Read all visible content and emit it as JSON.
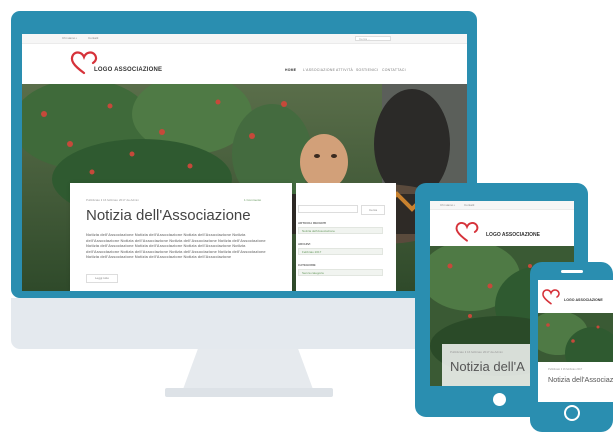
{
  "site": {
    "logo_text": "LOGO ASSOCIAZIONE",
    "topbar_links": [
      "Chi siamo  •",
      "Contatti"
    ],
    "search_placeholder": "Cerca ...",
    "nav": [
      "HOME",
      "L'ASSOCIAZIONE",
      "ATTIVITÀ",
      "SOSTIENICI",
      "CONTATTACI"
    ]
  },
  "article": {
    "meta": "Pubblicato il 16 febbraio 2017 da Admin",
    "comments": "1 Commento",
    "title": "Notizia dell'Associazione",
    "body": "Notizia dell'Associazione Notizia dell'Associazione Notizia dell'Associazione Notizia dell'Associazione Notizia dell'Associazione Notizia dell'Associazione Notizia dell'Associazione Notizia dell'Associazione Notizia dell'Associazione Notizia dell'Associazione Notizia dell'Associazione Notizia dell'Associazione Notizia dell'Associazione Notizia dell'Associazione Notizia dell'Associazione Notizia dell'Associazione Notizia dell'Associazione",
    "read_more": "Leggi tutto"
  },
  "sidebar": {
    "search_btn": "Cerca",
    "sections": [
      {
        "heading": "ARTICOLI RECENTI",
        "item": "Notizia dell'Associazione"
      },
      {
        "heading": "ARCHIVI",
        "item": "Febbraio 2017"
      },
      {
        "heading": "CATEGORIE",
        "item": "Senza categoria"
      }
    ]
  },
  "tablet": {
    "topbar_links": [
      "Chi siamo  •",
      "Contatti"
    ],
    "logo_text": "LOGO ASSOCIAZIONE",
    "meta": "Pubblicato il 16 febbraio 2017 da Admin",
    "title": "Notizia dell'A"
  },
  "phone": {
    "logo_text": "LOGO ASSOCIAZIONE",
    "meta": "Pubblicato il 16 febbraio 2017",
    "title": "Notizia dell'Associazione"
  },
  "colors": {
    "device_frame": "#2a8eb0",
    "logo_red": "#d6323a",
    "link_green": "#6a9b62"
  }
}
